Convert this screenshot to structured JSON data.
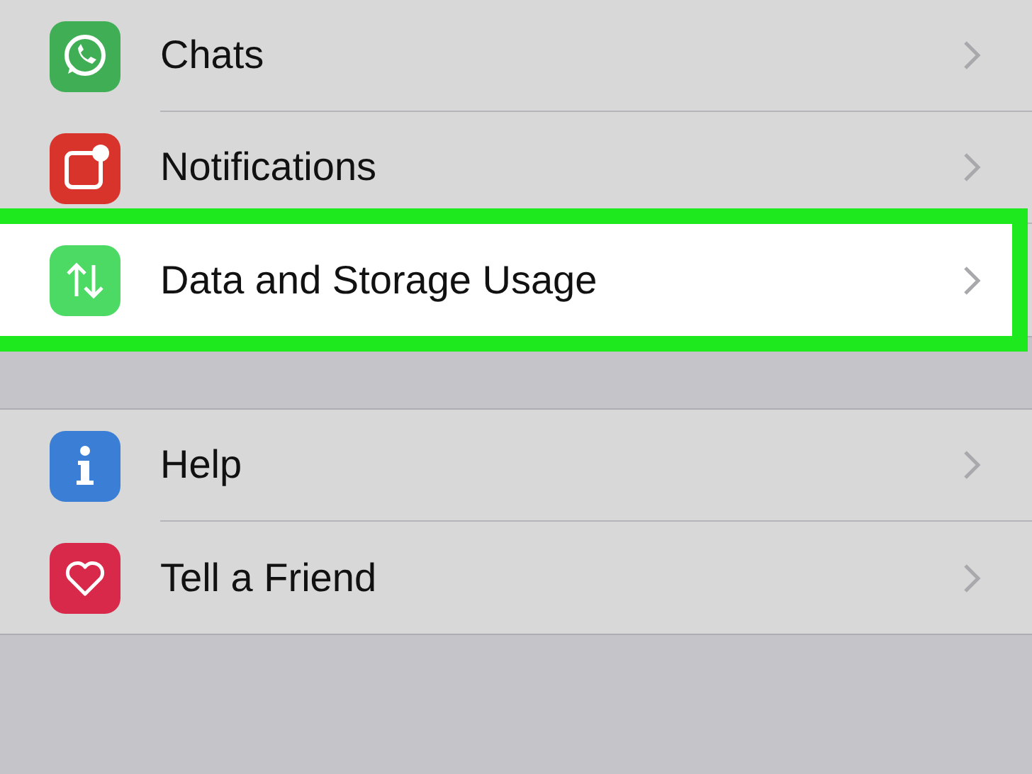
{
  "sections": [
    {
      "items": [
        {
          "label": "Chats",
          "kind": "chat",
          "color": "#3fae55",
          "highlighted": false
        },
        {
          "label": "Notifications",
          "kind": "notification",
          "color": "#d9342b",
          "highlighted": false
        },
        {
          "label": "Data and Storage Usage",
          "kind": "data",
          "color": "#4cd964",
          "highlighted": true
        }
      ]
    },
    {
      "items": [
        {
          "label": "Help",
          "kind": "info",
          "color": "#3a7fd5",
          "highlighted": false
        },
        {
          "label": "Tell a Friend",
          "kind": "heart",
          "color": "#d8294a",
          "highlighted": false
        }
      ]
    }
  ]
}
